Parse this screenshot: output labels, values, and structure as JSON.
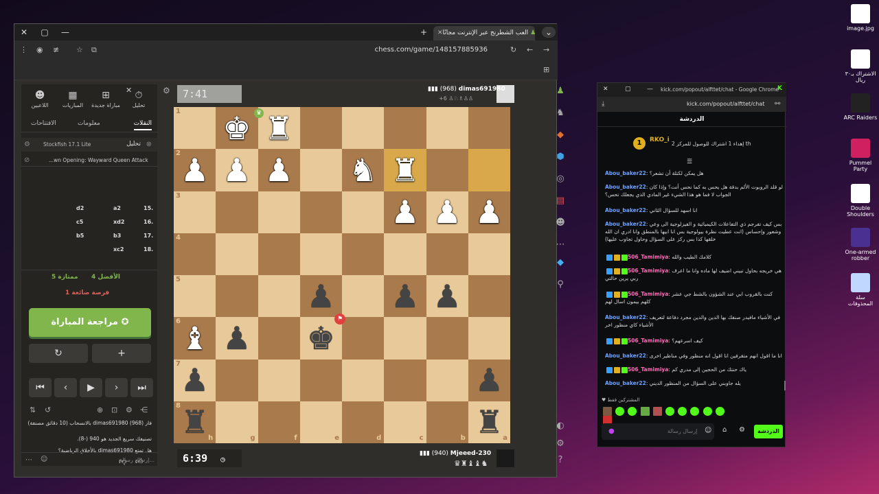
{
  "desktop_icons": [
    {
      "label": "image.jpg",
      "icon": "chrome-icon",
      "color": "#ffffff"
    },
    {
      "label": "الاشتراك بـ٣٠ ريال",
      "icon": "document-icon",
      "color": "#ffffff"
    },
    {
      "label": "ARC Raiders",
      "icon": "arc-raiders-icon",
      "color": "#222222"
    },
    {
      "label": "Pummel Party",
      "icon": "pummel-party-icon",
      "color": "#d02060"
    },
    {
      "label": "Double Shoulders",
      "icon": "double-shoulders-icon",
      "color": "#ffffff"
    },
    {
      "label": "One-armed robber",
      "icon": "one-armed-robber-icon",
      "color": "#4a3090"
    },
    {
      "label": "سلة المحذوفات",
      "icon": "recycle-bin-icon",
      "color": "#c0d8ff"
    }
  ],
  "chess_window": {
    "tab_title": "العب الشطرنج عبر الإنترنت مجانًا",
    "url": "chess.com/game/148157885936",
    "nav": [
      {
        "label": "تحليل",
        "icon": "stopwatch-icon"
      },
      {
        "label": "مباراة جديدة",
        "icon": "plus-icon"
      },
      {
        "label": "المباريات",
        "icon": "grid-icon"
      },
      {
        "label": "اللاعبين",
        "icon": "people-icon"
      }
    ],
    "subtabs": [
      "النقلات",
      "معلومات",
      "الافتتاحات"
    ],
    "engine": {
      "label": "تحليل",
      "name": "Stockfish 17.1 Lite"
    },
    "opening": "...wn Opening: Wayward Queen Attack",
    "moves": [
      {
        "num": "15.",
        "white": "a2",
        "black": "d2"
      },
      {
        "num": "16.",
        "white": "xd2",
        "black": "c5"
      },
      {
        "num": "17.",
        "white": "b3",
        "black": "b5"
      },
      {
        "num": "18.",
        "white": "xc2",
        "black": ""
      }
    ],
    "stats": {
      "best": "4 الأفضل",
      "excellent": "5 ممتازة",
      "missed": "1 فرصة ضائعة"
    },
    "review_button": "مراجعة المباراة",
    "result_text": "فاز dimas691980 (968) بالانسحاب (10 دقائق مصنفة)",
    "rating_text": "تصنيفك سريع الجديد هو 940 (-8).",
    "sportsmanship_text": "هل تمتع dimas691980 بالأخلاق الرياضية؟",
    "chat_placeholder": "إرسال رسالة...",
    "top_player": {
      "name": "dimas691980",
      "rating": "(968)",
      "clock": "7:41",
      "material": "+6"
    },
    "bottom_player": {
      "name": "Mjeeed-230",
      "rating": "(940)",
      "clock": "6:39"
    },
    "files": [
      "h",
      "g",
      "f",
      "e",
      "d",
      "c",
      "b",
      "a"
    ],
    "ranks": [
      "1",
      "2",
      "3",
      "4",
      "5",
      "6",
      "7",
      "8"
    ],
    "board": [
      [
        "",
        "wK",
        "wR",
        "",
        "",
        "",
        "",
        ""
      ],
      [
        "wP",
        "wP",
        "wP",
        "",
        "wN",
        "wR",
        "",
        ""
      ],
      [
        "",
        "",
        "",
        "",
        "",
        "wP",
        "wP",
        "wP"
      ],
      [
        "",
        "",
        "",
        "",
        "",
        "",
        "",
        ""
      ],
      [
        "",
        "",
        "",
        "bP",
        "",
        "bP",
        "bP",
        ""
      ],
      [
        "wB",
        "bP",
        "",
        "bK",
        "",
        "",
        "",
        ""
      ],
      [
        "bP",
        "",
        "",
        "",
        "",
        "",
        "",
        "bP"
      ],
      [
        "bR",
        "",
        "",
        "",
        "",
        "",
        "",
        "bR"
      ]
    ]
  },
  "kick_window": {
    "title": "kick.com/popout/alfttet/chat - Google Chrome",
    "url": "kick.com/popout/alfttet/chat",
    "header": "الدردشة",
    "pinned_user": "RKO_i",
    "pinned_text": "إهداء 1 اشتراك للوصول للمركز 2 th",
    "messages": [
      {
        "user": "Abou_baker22",
        "text": "هل يمكن لكتلة أن تشعر؟",
        "type": "u1"
      },
      {
        "user": "Abou_baker22",
        "text": "لو قلد الروبوت الألم بدقة هل يحس به كما نحس أنت؟ وإذا كان الجواب لا فما هو هذا الشيء غير المادي الذي يجعلك تحس؟",
        "type": "u1"
      },
      {
        "user": "Abou_baker22",
        "text": "انا اسهد للسؤال الثاني",
        "type": "u1"
      },
      {
        "user": "Abou_baker22",
        "text": "بس كيف تفرجم ذي التفاعلات الكيميائية و الفيزلوجية الى وعي وشعور وإحساس (انت عطيت نظرة بيولوجية بس انا ابيها بالمنطق وانا ادري ان الله خلقها كذا بس ركز على السؤال وحاول تجاوب عليها)",
        "type": "u1"
      },
      {
        "user": "506_Tamimiya",
        "text": "كلامك الطيب والله",
        "type": "u2"
      },
      {
        "user": "506_Tamimiya",
        "text": "هي خريجه بحاول تبيني اضيف لها ماده وانا ما اعرف ربي يرين حالتي",
        "type": "u2"
      },
      {
        "user": "506_Tamimiya",
        "text": "كنت بالقروب ابي عند الشؤون بالشط جي عشر كلهم بيمون اسال لهم",
        "type": "u2"
      },
      {
        "user": "Abou_baker22",
        "text": "في الأشياء مافيدر صنفك بها الدين والدين مجرد دفاعة لتعريف الأشياء كاي منظور اخر",
        "type": "u1"
      },
      {
        "user": "506_Tamimiya",
        "text": "كيف اسرعهم؟",
        "type": "u2"
      },
      {
        "user": "Abou_baker22",
        "text": "انا ما اقول انهم متقرفين انا اقول انه منظور وفي مناظير اخرى",
        "type": "u1"
      },
      {
        "user": "506_Tamimiya",
        "text": "ياك حنتك من الحجين إلى مدري كم",
        "type": "u2"
      },
      {
        "user": "Abou_baker22",
        "text": "يله جاوبني على السؤال من المنظور الديني",
        "type": "u1"
      }
    ],
    "subscribers_label": "المشتركين فقط",
    "input_placeholder": "إرسال رسالة",
    "chat_button": "الدردشة"
  }
}
